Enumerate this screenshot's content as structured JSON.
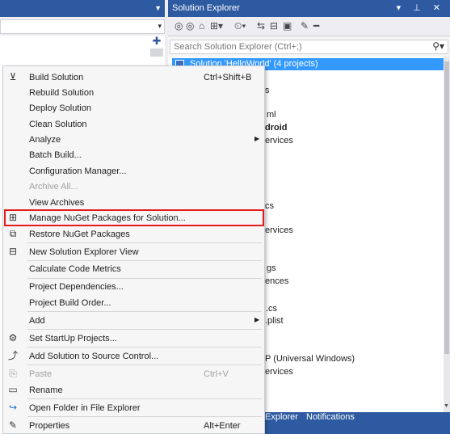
{
  "solution_explorer": {
    "title": "Solution Explorer",
    "window_controls": "▾ ⊥ ✕",
    "toolbar_icons": [
      "back-icon",
      "forward-icon",
      "home-icon",
      "switch-views-icon",
      "pending-changes-icon",
      "sync-icon",
      "collapse-all-icon",
      "show-all-files-icon",
      "properties-icon",
      "preview-icon"
    ],
    "search_placeholder": "Search Solution Explorer (Ctrl+;)",
    "selected_node": "Solution 'HelloWorld' (4 projects)",
    "visible_fragments": [
      "s",
      "ml",
      "droid",
      "ervices",
      "cs",
      "ervices",
      "gs",
      "ences",
      ".cs",
      ".plist",
      "P (Universal Windows)",
      "ervices"
    ],
    "bottom_tabs": [
      "Explorer",
      "Notifications"
    ]
  },
  "context_menu": {
    "highlight_color": "#e41b1b",
    "items": [
      {
        "icon": "build-icon",
        "label": "Build Solution",
        "shortcut": "Ctrl+Shift+B",
        "disabled": false,
        "submenu": false
      },
      {
        "icon": "",
        "label": "Rebuild Solution",
        "shortcut": "",
        "disabled": false,
        "submenu": false
      },
      {
        "icon": "",
        "label": "Deploy Solution",
        "shortcut": "",
        "disabled": false,
        "submenu": false
      },
      {
        "icon": "",
        "label": "Clean Solution",
        "shortcut": "",
        "disabled": false,
        "submenu": false
      },
      {
        "icon": "",
        "label": "Analyze",
        "shortcut": "",
        "disabled": false,
        "submenu": true
      },
      {
        "icon": "",
        "label": "Batch Build...",
        "shortcut": "",
        "disabled": false,
        "submenu": false
      },
      {
        "icon": "",
        "label": "Configuration Manager...",
        "shortcut": "",
        "disabled": false,
        "submenu": false
      },
      {
        "icon": "",
        "label": "Archive All...",
        "shortcut": "",
        "disabled": true,
        "submenu": false
      },
      {
        "icon": "",
        "label": "View Archives",
        "shortcut": "",
        "disabled": false,
        "submenu": false
      },
      {
        "icon": "nuget-icon",
        "label": "Manage NuGet Packages for Solution...",
        "shortcut": "",
        "disabled": false,
        "submenu": false
      },
      {
        "icon": "restore-nuget-icon",
        "label": "Restore NuGet Packages",
        "shortcut": "",
        "disabled": false,
        "submenu": false
      },
      {
        "icon": "new-view-icon",
        "label": "New Solution Explorer View",
        "shortcut": "",
        "disabled": false,
        "submenu": false
      },
      {
        "icon": "",
        "label": "Calculate Code Metrics",
        "shortcut": "",
        "disabled": false,
        "submenu": false
      },
      {
        "icon": "",
        "label": "Project Dependencies...",
        "shortcut": "",
        "disabled": false,
        "submenu": false
      },
      {
        "icon": "",
        "label": "Project Build Order...",
        "shortcut": "",
        "disabled": false,
        "submenu": false
      },
      {
        "icon": "",
        "label": "Add",
        "shortcut": "",
        "disabled": false,
        "submenu": true
      },
      {
        "icon": "gear-icon",
        "label": "Set StartUp Projects...",
        "shortcut": "",
        "disabled": false,
        "submenu": false
      },
      {
        "icon": "source-control-icon",
        "label": "Add Solution to Source Control...",
        "shortcut": "",
        "disabled": false,
        "submenu": false
      },
      {
        "icon": "paste-icon",
        "label": "Paste",
        "shortcut": "Ctrl+V",
        "disabled": true,
        "submenu": false
      },
      {
        "icon": "rename-icon",
        "label": "Rename",
        "shortcut": "",
        "disabled": false,
        "submenu": false
      },
      {
        "icon": "open-folder-icon",
        "label": "Open Folder in File Explorer",
        "shortcut": "",
        "disabled": false,
        "submenu": false
      },
      {
        "icon": "wrench-icon",
        "label": "Properties",
        "shortcut": "Alt+Enter",
        "disabled": false,
        "submenu": false
      }
    ]
  }
}
